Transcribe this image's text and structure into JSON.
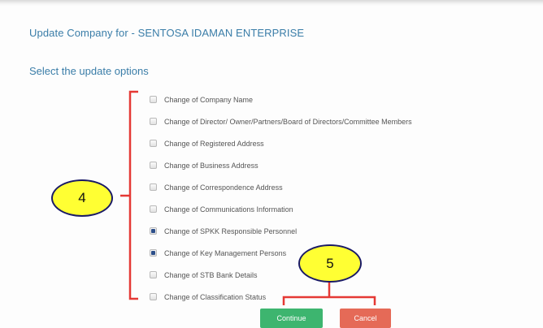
{
  "header": {
    "title": "Update Company for - SENTOSA IDAMAN ENTERPRISE",
    "subtitle": "Select the update options"
  },
  "options": [
    {
      "label": "Change of Company Name",
      "checked": false
    },
    {
      "label": "Change of Director/ Owner/Partners/Board of Directors/Committee Members",
      "checked": false
    },
    {
      "label": "Change of Registered Address",
      "checked": false
    },
    {
      "label": "Change of Business Address",
      "checked": false
    },
    {
      "label": "Change of Correspondence Address",
      "checked": false
    },
    {
      "label": "Change of Communications Information",
      "checked": false
    },
    {
      "label": "Change of SPKK Responsible Personnel",
      "checked": true
    },
    {
      "label": "Change of Key Management Persons",
      "checked": true
    },
    {
      "label": "Change of STB Bank Details",
      "checked": false
    },
    {
      "label": "Change of Classification Status",
      "checked": false
    }
  ],
  "actions": {
    "continue_label": "Continue",
    "cancel_label": "Cancel"
  },
  "annotations": {
    "step4": "4",
    "step5": "5",
    "bracket_color": "#e53935",
    "bubble_color": "#ffff33"
  },
  "colors": {
    "heading": "#3a7da8",
    "continue": "#3db56f",
    "cancel": "#e56a57"
  }
}
